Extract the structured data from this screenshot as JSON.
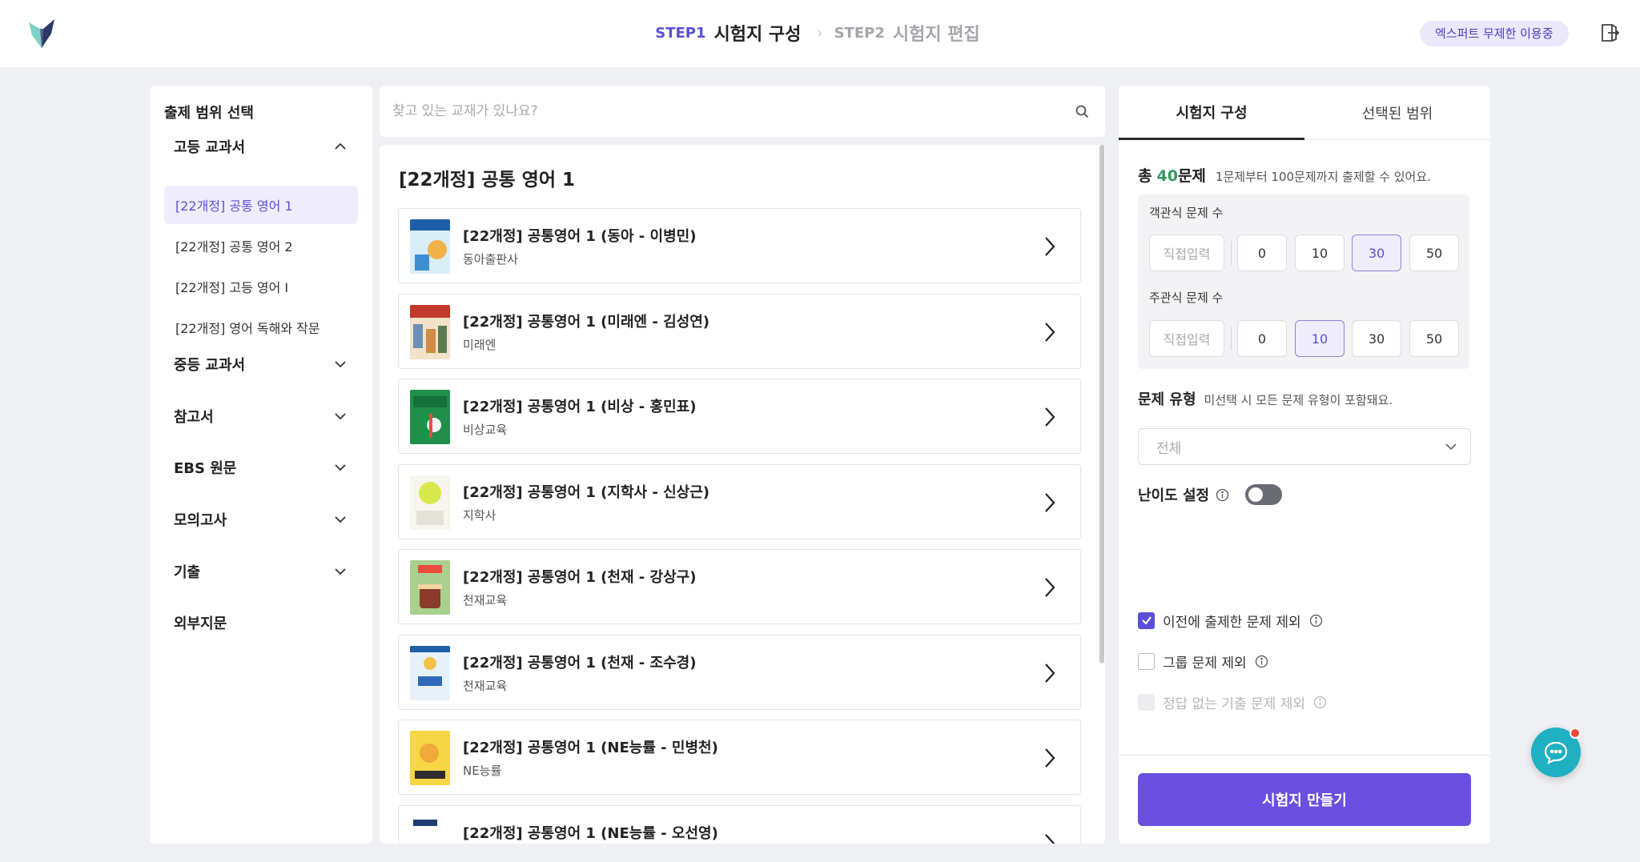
{
  "header": {
    "step1_num": "STEP1",
    "step1_title": "시험지 구성",
    "step2_num": "STEP2",
    "step2_title": "시험지 편집",
    "badge": "엑스퍼트 무제한 이용중"
  },
  "sidebar": {
    "title": "출제 범위 선택",
    "categories": [
      {
        "label": "고등 교과서",
        "expanded": true
      },
      {
        "label": "중등 교과서"
      },
      {
        "label": "참고서"
      },
      {
        "label": "EBS 원문"
      },
      {
        "label": "모의고사"
      },
      {
        "label": "기출"
      },
      {
        "label": "외부지문"
      }
    ],
    "subitems": [
      "[22개정] 공통 영어 1",
      "[22개정] 공통 영어 2",
      "[22개정] 고등 영어 I",
      "[22개정] 영어 독해와 작문"
    ]
  },
  "search": {
    "placeholder": "찾고 있는 교재가 있나요?"
  },
  "book_list": {
    "title": "[22개정] 공통 영어 1",
    "books": [
      {
        "name": "[22개정] 공통영어 1 (동아 - 이병민)",
        "publisher": "동아출판사"
      },
      {
        "name": "[22개정] 공통영어 1 (미래엔 - 김성연)",
        "publisher": "미래엔"
      },
      {
        "name": "[22개정] 공통영어 1 (비상 - 홍민표)",
        "publisher": "비상교육"
      },
      {
        "name": "[22개정] 공통영어 1 (지학사 - 신상근)",
        "publisher": "지학사"
      },
      {
        "name": "[22개정] 공통영어 1 (천재 - 강상구)",
        "publisher": "천재교육"
      },
      {
        "name": "[22개정] 공통영어 1 (천재 - 조수경)",
        "publisher": "천재교육"
      },
      {
        "name": "[22개정] 공통영어 1 (NE능률 - 민병천)",
        "publisher": "NE능률"
      },
      {
        "name": "[22개정] 공통영어 1 (NE능률 - 오선영)",
        "publisher": ""
      }
    ]
  },
  "config": {
    "tab_compose": "시험지 구성",
    "tab_selected": "선택된 범위",
    "total_prefix": "총",
    "total_num": "40",
    "total_suffix": "문제",
    "total_hint": "1문제부터 100문제까지 출제할 수 있어요.",
    "objective_label": "객관식 문제 수",
    "subjective_label": "주관식 문제 수",
    "direct_input": "직접입력",
    "options": [
      "0",
      "10",
      "30",
      "50"
    ],
    "objective_selected": "30",
    "subjective_selected": "10",
    "type_label": "문제 유형",
    "type_hint": "미선택 시 모든 문제 유형이 포함돼요.",
    "type_value": "전체",
    "difficulty_label": "난이도 설정",
    "difficulty_on": false,
    "check_prev": "이전에 출제한 문제 제외",
    "check_group": "그룹 문제 제외",
    "check_noanswer": "정답 없는 기출 문제 제외",
    "create_button": "시험지 만들기"
  },
  "colors": {
    "accent": "#5b4fd8",
    "button": "#6a4fe0",
    "total_number": "#2e9a5c",
    "chat": "#1fb0c2"
  }
}
